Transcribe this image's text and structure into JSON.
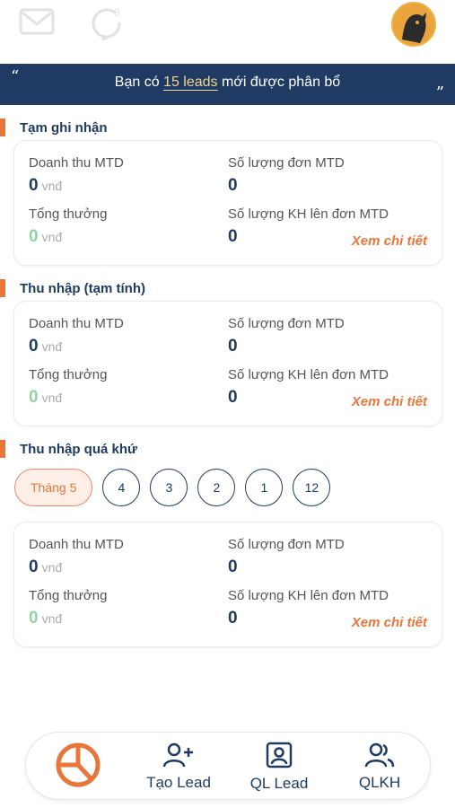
{
  "header": {
    "icons": [
      "mail-icon",
      "chat-notification-icon"
    ],
    "avatar": "avatar"
  },
  "banner": {
    "open_quote": "“",
    "close_quote": "”",
    "prefix": "Bạn có",
    "highlight": "15 leads",
    "suffix": "mới được phân bổ"
  },
  "sections": [
    {
      "title": "Tạm ghi nhận",
      "revenue_label": "Doanh thu MTD",
      "revenue_value": "0",
      "revenue_unit": "vnđ",
      "orders_label": "Số lượng đơn MTD",
      "orders_value": "0",
      "bonus_label": "Tổng thưởng",
      "bonus_value": "0",
      "bonus_unit": "vnđ",
      "customers_label": "Số lượng KH lên đơn MTD",
      "customers_value": "0",
      "detail_link": "Xem chi tiết"
    },
    {
      "title": "Thu nhập (tạm tính)",
      "revenue_label": "Doanh thu MTD",
      "revenue_value": "0",
      "revenue_unit": "vnđ",
      "orders_label": "Số lượng đơn MTD",
      "orders_value": "0",
      "bonus_label": "Tổng thưởng",
      "bonus_value": "0",
      "bonus_unit": "vnđ",
      "customers_label": "Số lượng KH lên đơn MTD",
      "customers_value": "0",
      "detail_link": "Xem chi tiết"
    },
    {
      "title": "Thu nhập quá khứ",
      "revenue_label": "Doanh thu MTD",
      "revenue_value": "0",
      "revenue_unit": "vnđ",
      "orders_label": "Số lượng đơn MTD",
      "orders_value": "0",
      "bonus_label": "Tổng thưởng",
      "bonus_value": "0",
      "bonus_unit": "vnđ",
      "customers_label": "Số lượng KH lên đơn MTD",
      "customers_value": "0",
      "detail_link": "Xem chi tiết"
    }
  ],
  "months": {
    "selected": "Tháng 5",
    "others": [
      "4",
      "3",
      "2",
      "1",
      "12"
    ]
  },
  "bottom_nav": {
    "items": [
      {
        "label": "",
        "icon": "pie-chart-icon"
      },
      {
        "label": "Tạo Lead",
        "icon": "add-user-icon"
      },
      {
        "label": "QL Lead",
        "icon": "contact-card-icon"
      },
      {
        "label": "QLKH",
        "icon": "users-icon"
      }
    ]
  },
  "colors": {
    "primary": "#1f3b64",
    "accent": "#e8763a",
    "highlight": "#f2d68e",
    "positive": "#8ed4a6"
  }
}
